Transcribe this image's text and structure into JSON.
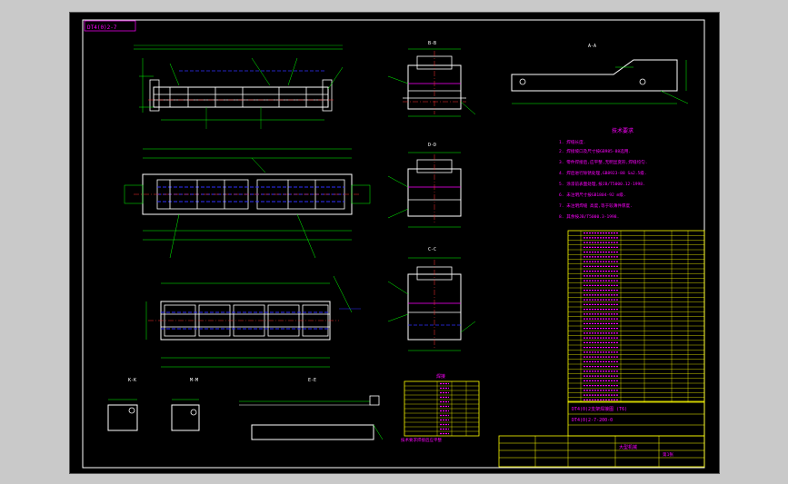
{
  "sheet": {
    "tag": "DT4(0)2-7"
  },
  "views": {
    "view_b": "B-B",
    "view_d": "D-D",
    "view_c": "C-C",
    "view_a": "A-A",
    "detail_e": "E-E",
    "view_label1": "B",
    "view_label2": "D",
    "view_label3": "C",
    "view_k": "K-K",
    "view_m": "M-M"
  },
  "notes": {
    "title": "技术要求",
    "lines": [
      "1. 焊缝长度.",
      "2. 焊接坡口及尺寸按GB985-88选用.",
      "3. 零件焊接后,应平整,无明显变形,焊缝均匀.",
      "4. 焊后进行除锈处理,GB8923-88 Sa2.5级.",
      "5. 涂漆前表面处理,按JB/T5000.12-1998.",
      "6. 未注明尺寸按GB1804-92 m级.",
      "7. 未注明焊缝 高度,等于较薄件厚度.",
      "8. 其余按JB/T5000.3-1998."
    ]
  },
  "title_block": {
    "drawing_title": "DT4(0)2支架焊接图 (T6)",
    "drawing_no": "DT4(0)2-7-200-0",
    "company": "大型机械",
    "sheet_no": "第1张"
  },
  "small_table": {
    "header": "焊接",
    "note": "技术要求焊接后应平整"
  },
  "colors": {
    "background": "#000000",
    "outline": "#ffffff",
    "dimension": "#00ff00",
    "text": "#ff00ff",
    "hidden": "#0000ff",
    "center": "#ff3030",
    "table": "#ffff00",
    "accent": "#00ffff"
  }
}
